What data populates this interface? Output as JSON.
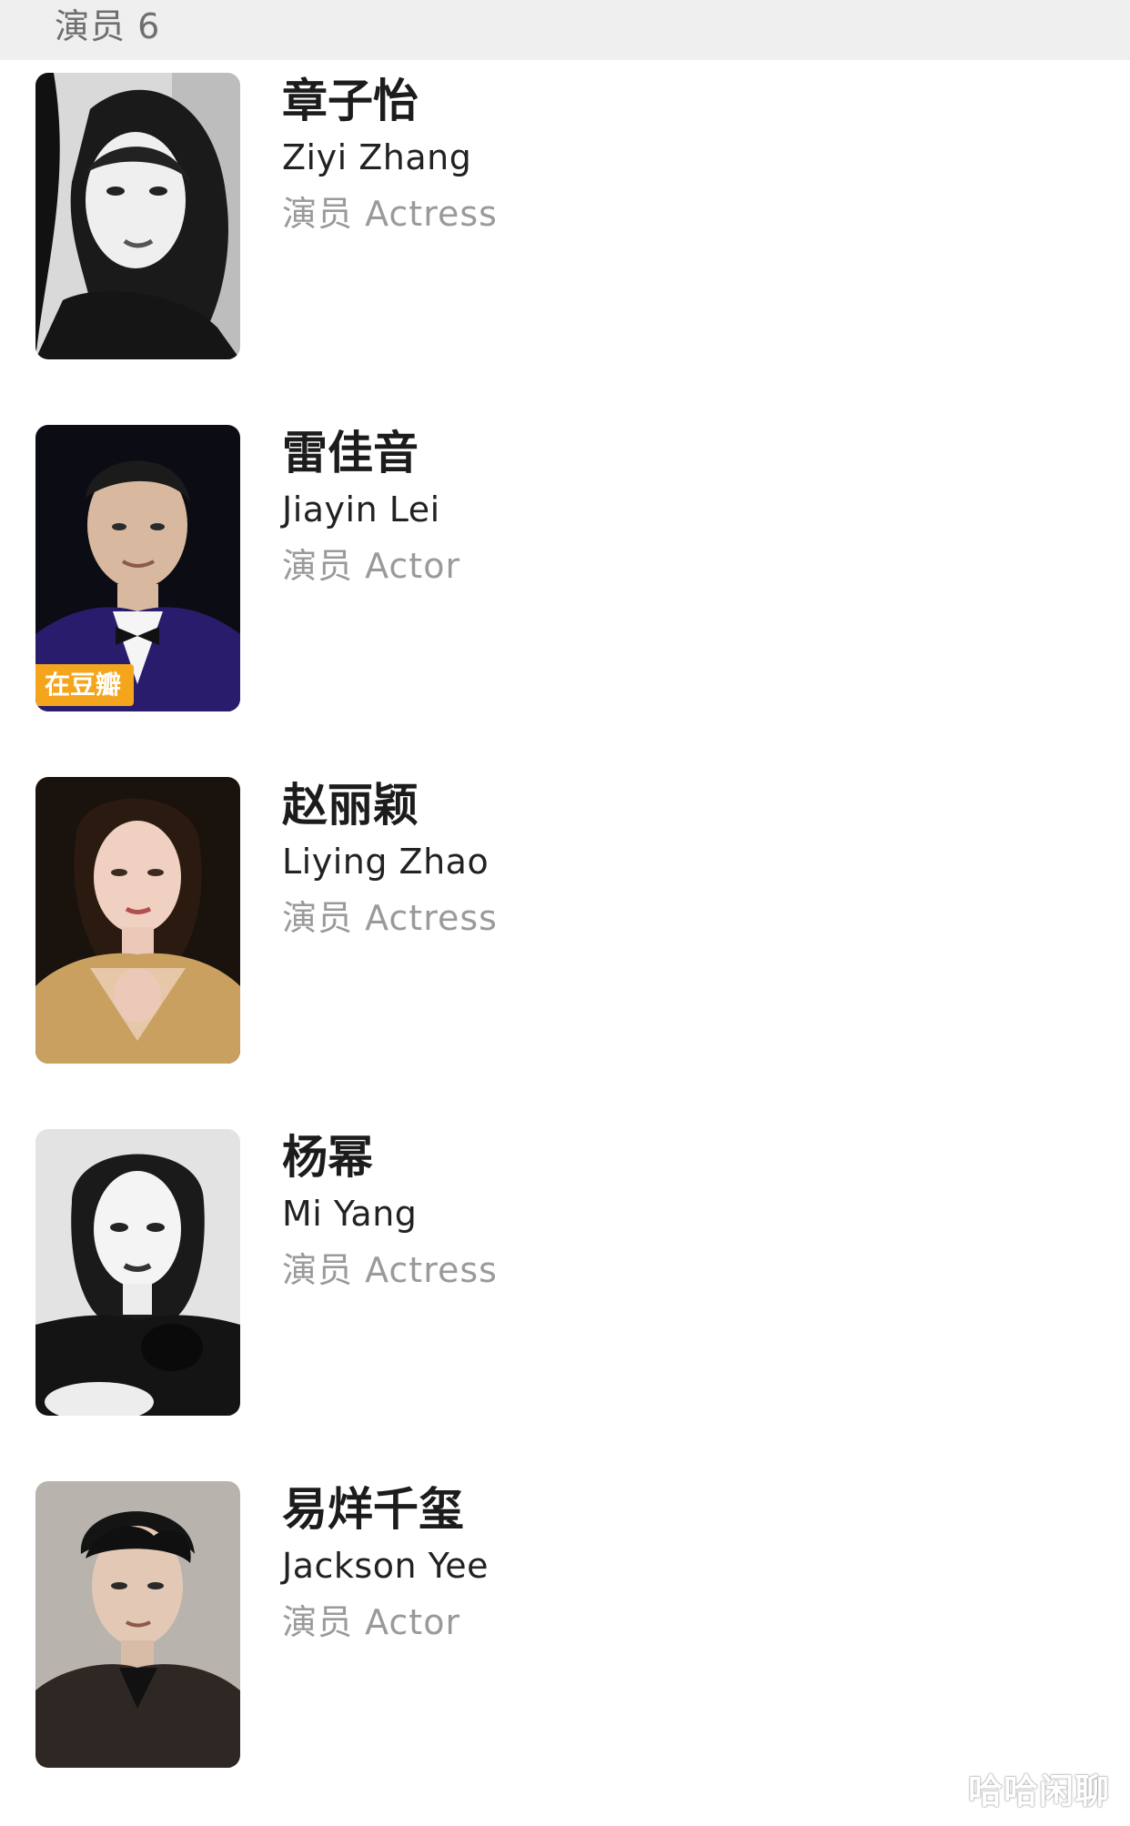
{
  "section": {
    "title": "演员 6"
  },
  "cast": [
    {
      "name_zh": "章子怡",
      "name_en": "Ziyi Zhang",
      "role": "演员 Actress",
      "badge": "",
      "photo_icon": "person-portrait-bw"
    },
    {
      "name_zh": "雷佳音",
      "name_en": "Jiayin Lei",
      "role": "演员 Actor",
      "badge": "在豆瓣",
      "photo_icon": "person-portrait-color"
    },
    {
      "name_zh": "赵丽颖",
      "name_en": "Liying Zhao",
      "role": "演员 Actress",
      "badge": "",
      "photo_icon": "person-portrait-color"
    },
    {
      "name_zh": "杨幂",
      "name_en": "Mi Yang",
      "role": "演员 Actress",
      "badge": "",
      "photo_icon": "person-portrait-bw"
    },
    {
      "name_zh": "易烊千玺",
      "name_en": "Jackson Yee",
      "role": "演员 Actor",
      "badge": "",
      "photo_icon": "person-portrait-color"
    }
  ],
  "watermark": "哈哈闲聊",
  "colors": {
    "header_bg": "#efefef",
    "badge_bg": "#f4a51c",
    "role_text": "#9a9a9a"
  }
}
